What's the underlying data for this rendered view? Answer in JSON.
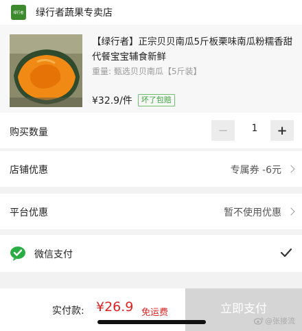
{
  "store": {
    "logo_text": "绿行者",
    "name": "绿行者蔬果专卖店"
  },
  "product": {
    "title": "【绿行者】正宗贝贝南瓜5斤板栗味南瓜粉糯香甜代餐宝宝辅食新鲜",
    "spec": "重量: 甄选贝贝南瓜【5斤装】",
    "price": "¥32.9/件",
    "badge": "坏了包赔"
  },
  "quantity": {
    "label": "购买数量",
    "value": "1",
    "minus": "−",
    "plus": "+"
  },
  "store_discount": {
    "label": "店铺优惠",
    "value": "专属券 -6元"
  },
  "platform_discount": {
    "label": "平台优惠",
    "value": "暂不使用优惠"
  },
  "payment": {
    "method": "微信支付",
    "icon": "wechat-icon",
    "selected": true
  },
  "footer": {
    "total_label": "实付款:",
    "total_amount": "¥26.9",
    "shipping": "免运费",
    "pay_button": "立即支付"
  },
  "watermark": {
    "text": "@张接流"
  },
  "colors": {
    "accent_red": "#e02020",
    "brand_green": "#3d8a2e",
    "wechat_green": "#2aae43"
  }
}
